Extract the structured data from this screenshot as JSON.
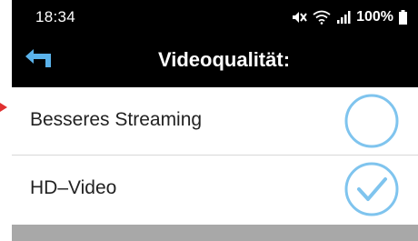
{
  "status_bar": {
    "time": "18:34",
    "battery": "100%",
    "icons": [
      "mute-icon",
      "wifi-icon",
      "signal-icon",
      "battery-icon"
    ]
  },
  "app_bar": {
    "title": "Videoqualität:",
    "back_icon": "back-arrow-icon"
  },
  "options": [
    {
      "label": "Besseres Streaming",
      "selected": false
    },
    {
      "label": "HD–Video",
      "selected": true
    }
  ],
  "colors": {
    "accent": "#7fc4ee",
    "back_icon": "#5ab2ea",
    "bar_background": "#000000",
    "divider": "#d8d8d8",
    "bottom_bar": "#a8a8a8"
  }
}
